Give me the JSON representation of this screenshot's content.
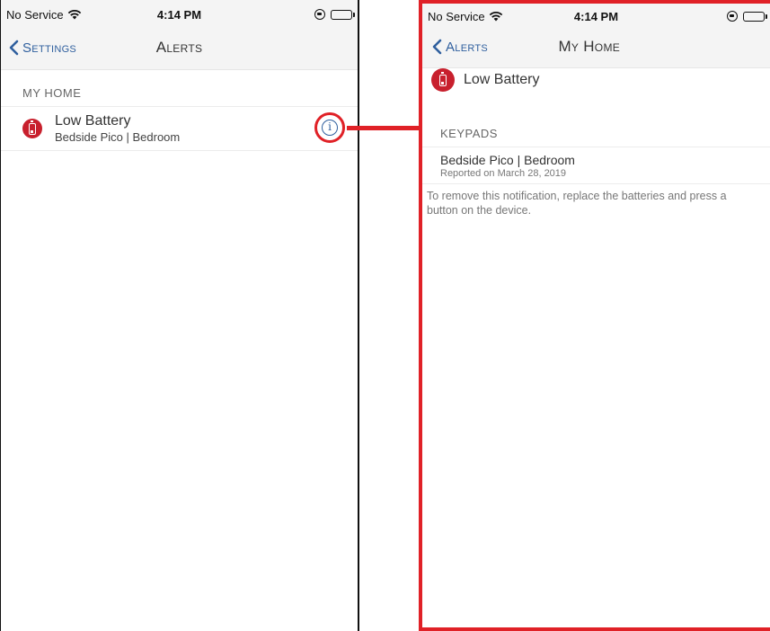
{
  "left": {
    "status": {
      "carrier": "No Service",
      "time": "4:14 PM"
    },
    "nav": {
      "back_label": "Settings",
      "title": "Alerts"
    },
    "section": "MY HOME",
    "alert": {
      "title": "Low Battery",
      "subtitle": "Bedside Pico | Bedroom",
      "info_glyph": "i"
    }
  },
  "right": {
    "status": {
      "carrier": "No Service",
      "time": "4:14 PM"
    },
    "nav": {
      "back_label": "Alerts",
      "title": "My Home"
    },
    "alert_title": "Low Battery",
    "section": "KEYPADS",
    "device": {
      "name": "Bedside Pico | Bedroom",
      "reported": "Reported on March 28, 2019"
    },
    "note": "To remove this notification, replace the batteries and press a button on the device."
  },
  "colors": {
    "accent_red": "#e02127",
    "link_blue": "#2f5f9e",
    "alert_icon_red": "#c8202d"
  },
  "icons": [
    "wifi-icon",
    "orientation-lock-icon",
    "battery-icon",
    "chevron-left-icon",
    "low-battery-icon",
    "info-icon"
  ]
}
